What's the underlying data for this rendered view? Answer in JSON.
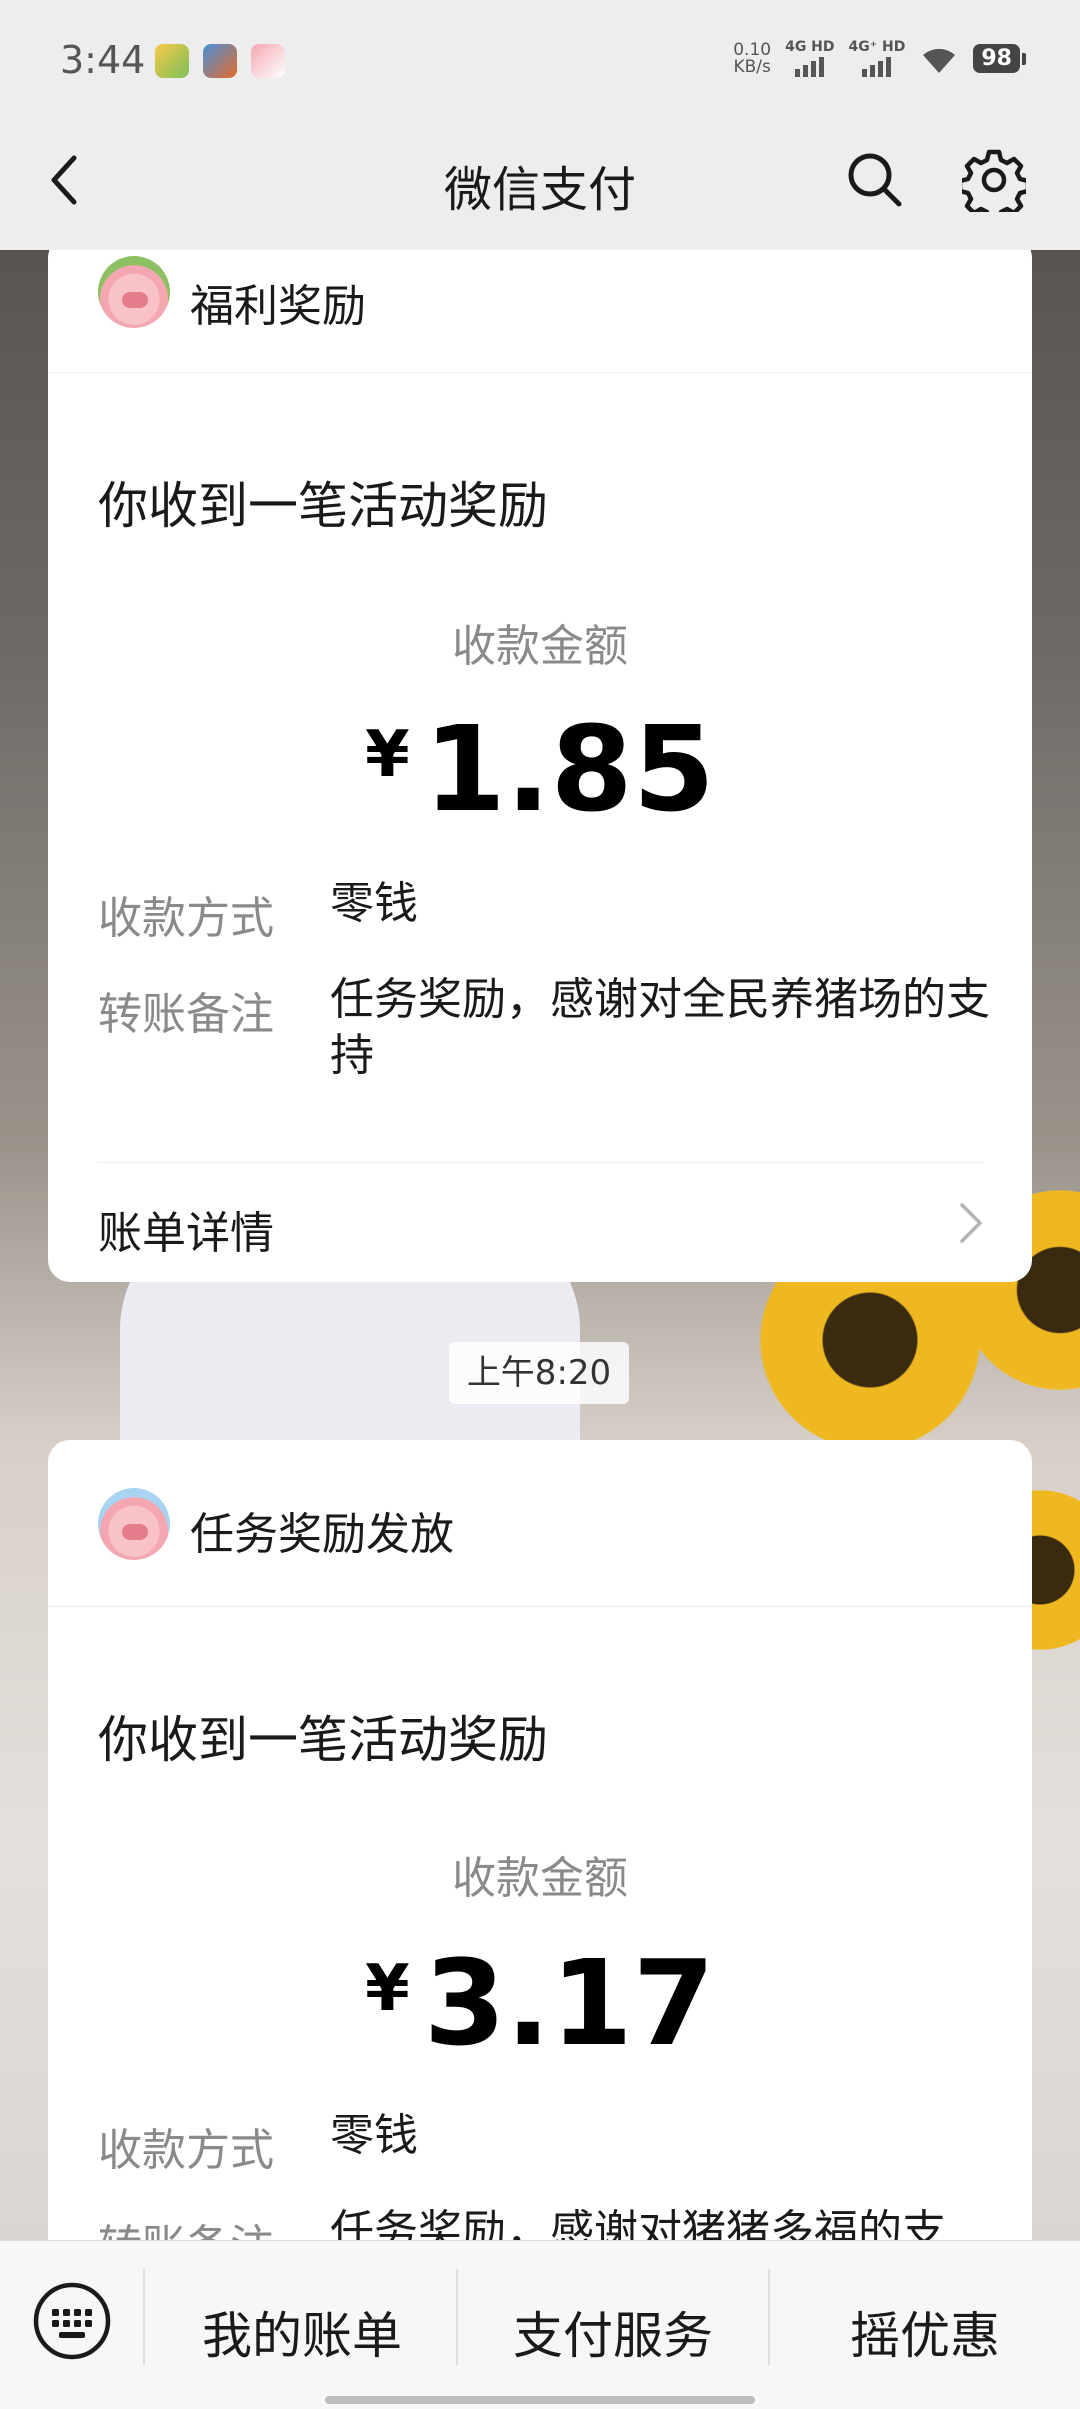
{
  "status_bar": {
    "time": "3:44",
    "net_speed_value": "0.10",
    "net_speed_unit": "KB/s",
    "signal1": "4G HD",
    "signal2": "4G⁺ HD",
    "battery": "98"
  },
  "header": {
    "title": "微信支付",
    "back_icon": "chevron-left-icon",
    "search_icon": "search-icon",
    "settings_icon": "gear-icon"
  },
  "messages": [
    {
      "sender": "福利奖励",
      "headline": "你收到一笔活动奖励",
      "amount_label": "收款金额",
      "currency": "¥",
      "amount": "1.85",
      "method_label": "收款方式",
      "method_value": "零钱",
      "note_label": "转账备注",
      "note_value": "任务奖励，感谢对全民养猪场的支持",
      "detail_label": "账单详情"
    },
    {
      "sender": "任务奖励发放",
      "headline": "你收到一笔活动奖励",
      "amount_label": "收款金额",
      "currency": "¥",
      "amount": "3.17",
      "method_label": "收款方式",
      "method_value": "零钱",
      "note_label": "转账备注",
      "note_value": "任务奖励，感谢对猪猪多福的支"
    }
  ],
  "timestamp": "上午8:20",
  "bottom_menu": {
    "keyboard_icon": "keyboard-icon",
    "items": [
      "我的账单",
      "支付服务",
      "摇优惠"
    ]
  },
  "colors": {
    "topbar_bg": "#ededed",
    "card_bg": "#ffffff",
    "muted_text": "#8a8a8a",
    "primary_text": "#1a1a1a"
  }
}
